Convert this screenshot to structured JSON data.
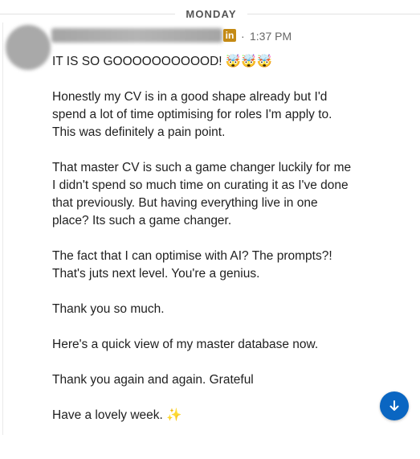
{
  "divider": {
    "day": "MONDAY"
  },
  "sender": {
    "badge_icon": "linkedin-icon",
    "badge_text": "in",
    "separator": "·",
    "time": "1:37 PM"
  },
  "message": {
    "line1": "IT IS SO GOOOOOOOOOOD! 🤯🤯🤯",
    "para2": [
      "Honestly my CV is in a good shape already but I'd",
      "spend a lot of time optimising for roles I'm apply to.",
      "This was definitely a pain point."
    ],
    "para3": [
      "That master CV is such a game changer luckily for me",
      "I didn't spend so much time on curating it as I've done",
      "that previously. But having everything live in one",
      "place? Its such a game changer."
    ],
    "para4": [
      "The fact that I can optimise with AI? The prompts?!",
      "That's juts next level. You're a genius."
    ],
    "para5": "Thank you so much.",
    "para6": "Here's a quick view of my master database now.",
    "para7": "Thank you again and again. Grateful",
    "para8": "Have a lovely week. ✨"
  },
  "controls": {
    "scroll_button_icon": "arrow-down-icon",
    "accent": "#0a66c2"
  }
}
